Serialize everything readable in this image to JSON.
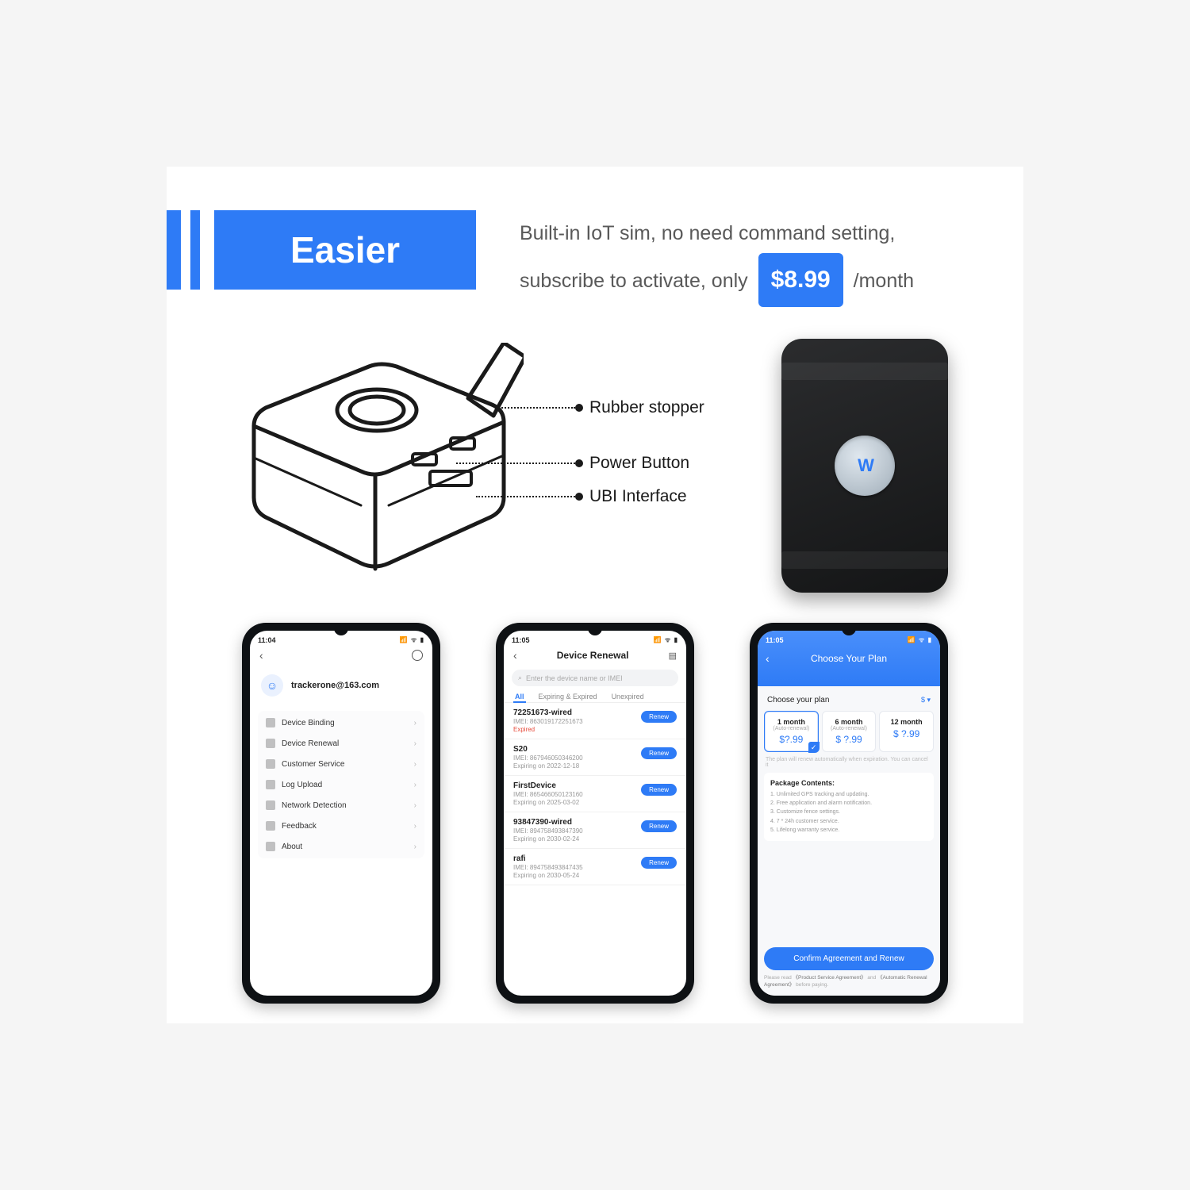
{
  "header": {
    "title": "Easier",
    "desc_line1": "Built-in IoT sim, no need command setting,",
    "desc_line2a": "subscribe to activate, only",
    "price": "$8.99",
    "desc_line2b": "/month"
  },
  "diagram": {
    "labels": [
      "Rubber stopper",
      "Power Button",
      "UBI Interface"
    ]
  },
  "phone1": {
    "time": "11:04",
    "email": "trackerone@163.com",
    "menu": [
      "Device Binding",
      "Device Renewal",
      "Customer Service",
      "Log Upload",
      "Network Detection",
      "Feedback",
      "About"
    ]
  },
  "phone2": {
    "time": "11:05",
    "title": "Device Renewal",
    "search_placeholder": "Enter the device name or IMEI",
    "tabs": [
      "All",
      "Expiring & Expired",
      "Unexpired"
    ],
    "renew_label": "Renew",
    "devices": [
      {
        "name": "72251673-wired",
        "imei": "IMEI:  863019172251673",
        "status": "Expired",
        "expired": true
      },
      {
        "name": "S20",
        "imei": "IMEI:  867946050346200",
        "status": "Expiring on 2022-12-18",
        "expired": false
      },
      {
        "name": "FirstDevice",
        "imei": "IMEI:  865466050123160",
        "status": "Expiring on 2025-03-02",
        "expired": false
      },
      {
        "name": "93847390-wired",
        "imei": "IMEI:  894758493847390",
        "status": "Expiring on 2030-02-24",
        "expired": false
      },
      {
        "name": "rafi",
        "imei": "IMEI:  894758493847435",
        "status": "Expiring on 2030-05-24",
        "expired": false
      }
    ]
  },
  "phone3": {
    "time": "11:05",
    "title": "Choose Your Plan",
    "choose": "Choose your plan",
    "unit": "$",
    "plans": [
      {
        "title": "1 month",
        "sub": "(Auto-renewal)",
        "price": "$?.99",
        "selected": true
      },
      {
        "title": "6 month",
        "sub": "(Auto-renewal)",
        "price": "$ ?.99",
        "selected": false
      },
      {
        "title": "12 month",
        "sub": "",
        "price": "$ ?.99",
        "selected": false
      }
    ],
    "note": "The plan will renew automatically when expiration. You can cancel it",
    "pkg_title": "Package Contents:",
    "pkg_items": [
      "1. Unlimited GPS tracking and updating.",
      "2. Free application and alarm notification.",
      "3. Customize fence settings.",
      "4. 7 * 24h customer service.",
      "5. Lifelong warranty service."
    ],
    "button": "Confirm Agreement and Renew",
    "disclaimer": "Please read 《Product Service Agreement》 and 《Automatic Renewal Agreement》 before paying."
  }
}
